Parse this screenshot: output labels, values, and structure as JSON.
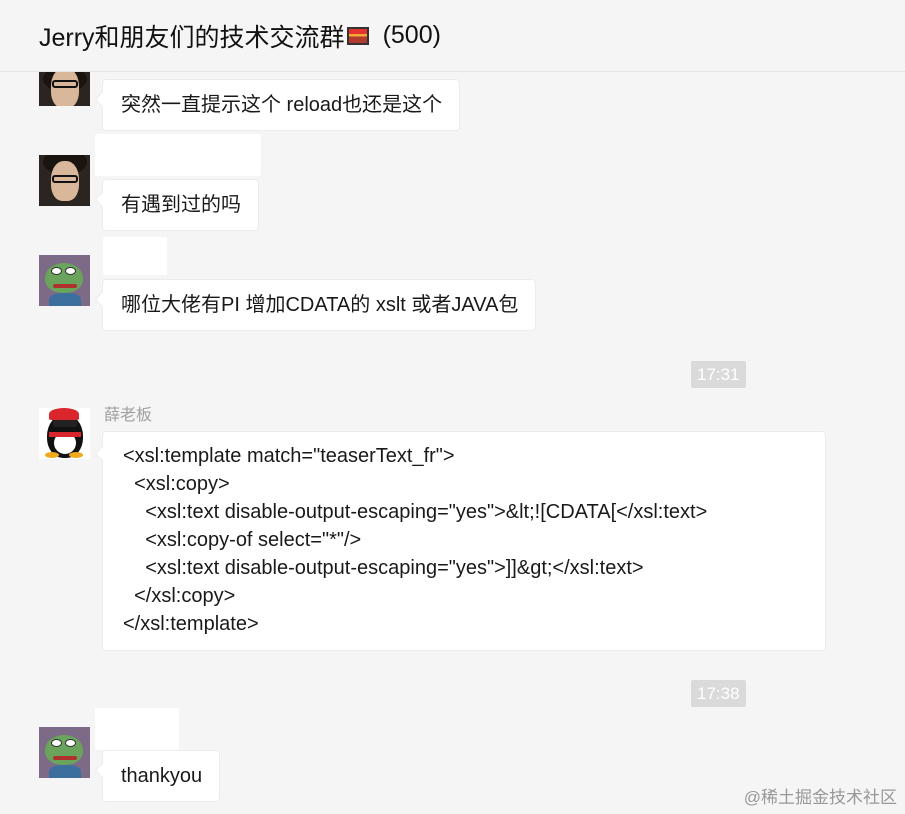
{
  "header": {
    "title": "Jerry和朋友们的技术交流群",
    "member_count": "(500)"
  },
  "messages": [
    {
      "text": "突然一直提示这个 reload也还是这个"
    },
    {
      "text": "有遇到过的吗"
    },
    {
      "text": "哪位大佬有PI 增加CDATA的 xslt 或者JAVA包"
    },
    {
      "sender": "薛老板"
    },
    {
      "text": "thankyou"
    }
  ],
  "code_message": {
    "lines": [
      "<xsl:template match=\"teaserText_fr\">",
      "  <xsl:copy>",
      "    <xsl:text disable-output-escaping=\"yes\">&lt;![CDATA[</xsl:text>",
      "    <xsl:copy-of select=\"*\"/>",
      "    <xsl:text disable-output-escaping=\"yes\">]]&gt;</xsl:text>",
      "  </xsl:copy>",
      "</xsl:template>"
    ]
  },
  "timestamps": [
    "17:31",
    "17:38"
  ],
  "watermark": "@稀土掘金技术社区",
  "avatars": [
    "man-glasses-avatar",
    "frog-avatar",
    "penguin-avatar"
  ]
}
